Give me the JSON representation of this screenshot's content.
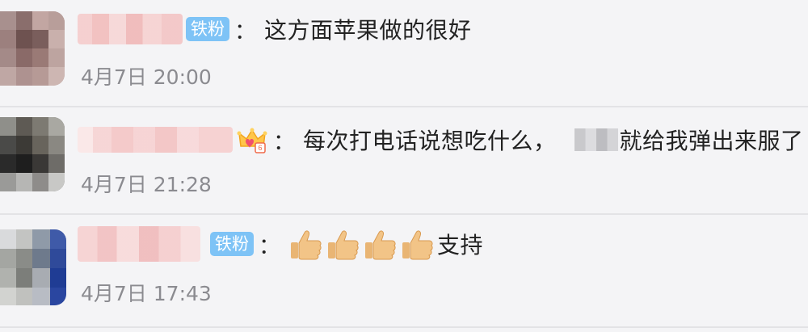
{
  "comments": [
    {
      "badge": "铁粉",
      "separator": "：",
      "text": "这方面苹果做的很好",
      "time": "4月7日 20:00"
    },
    {
      "badge_icon": "crown-icon",
      "separator": "：",
      "text_before": "每次打电话说想吃什么，",
      "text_after": "就给我弹出来服了",
      "time": "4月7日 21:28"
    },
    {
      "badge": "铁粉",
      "separator": "：",
      "emoji_icons": [
        "thumbs-up-icon",
        "thumbs-up-icon",
        "thumbs-up-icon",
        "thumbs-up-icon"
      ],
      "text": "支持",
      "time": "4月7日 17:43"
    }
  ],
  "colors": {
    "background": "#f4f4f6",
    "badge": "#7ec3f6",
    "text": "#222222",
    "time": "#8b8b90",
    "divider": "#e3e3e6"
  }
}
